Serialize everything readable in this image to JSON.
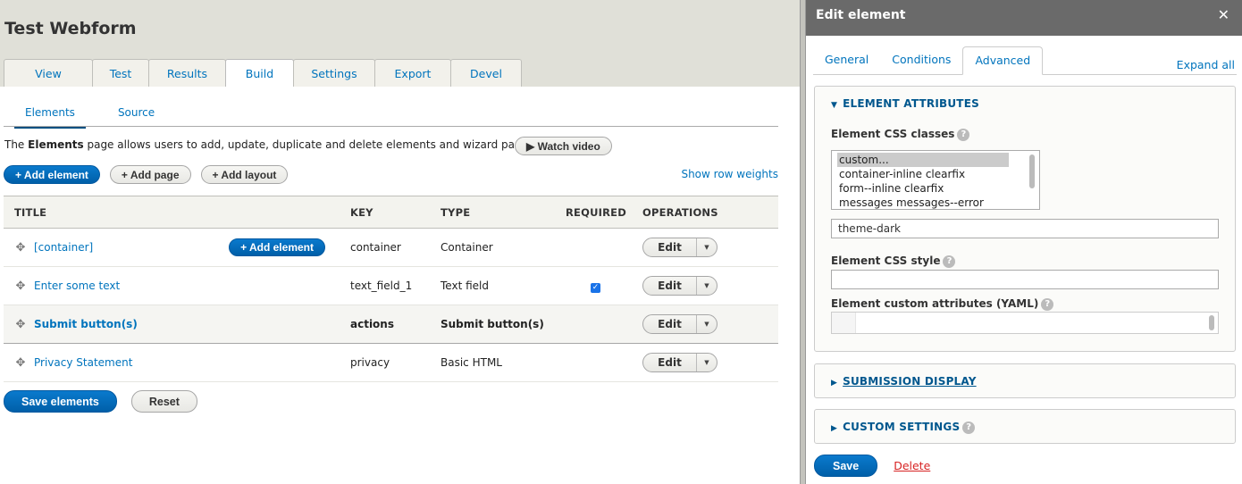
{
  "page": {
    "title": "Test Webform",
    "tabs": [
      {
        "label": "View",
        "active": false
      },
      {
        "label": "Test",
        "active": false
      },
      {
        "label": "Results",
        "active": false
      },
      {
        "label": "Build",
        "active": true
      },
      {
        "label": "Settings",
        "active": false
      },
      {
        "label": "Export",
        "active": false
      },
      {
        "label": "Devel",
        "active": false
      }
    ],
    "subtabs": [
      {
        "label": "Elements",
        "active": true
      },
      {
        "label": "Source",
        "active": false
      }
    ],
    "description": {
      "prefix": "The ",
      "bold": "Elements",
      "suffix": " page allows users to add, update, duplicate and delete elements and wizard pages."
    },
    "watch_video_label": "▶ Watch video",
    "buttons": {
      "add_element": "+ Add element",
      "add_page": "+ Add page",
      "add_layout": "+ Add layout"
    },
    "show_row_weights": "Show row weights",
    "table": {
      "columns": [
        "TITLE",
        "KEY",
        "TYPE",
        "REQUIRED",
        "OPERATIONS"
      ],
      "rows": [
        {
          "title": "[container]",
          "indent": false,
          "add_button": "+ Add element",
          "key": "container",
          "type": "Container",
          "required": false,
          "operation": "Edit"
        },
        {
          "title": "Enter some text",
          "indent": true,
          "key": "text_field_1",
          "type": "Text field",
          "required": true,
          "operation": "Edit"
        },
        {
          "title": "Submit button(s)",
          "indent": true,
          "key": "actions",
          "type": "Submit button(s)",
          "required": false,
          "operation": "Edit"
        },
        {
          "title": "Privacy Statement",
          "indent": false,
          "key": "privacy",
          "type": "Basic HTML",
          "required": false,
          "operation": "Edit"
        }
      ]
    },
    "save_label": "Save elements",
    "reset_label": "Reset"
  },
  "dialog": {
    "title": "Edit element",
    "close_glyph": "✕",
    "tabs": [
      {
        "label": "General",
        "active": false
      },
      {
        "label": "Conditions",
        "active": false
      },
      {
        "label": "Advanced",
        "active": true
      }
    ],
    "expand_all": "Expand all",
    "element_attributes": {
      "legend": "ELEMENT ATTRIBUTES",
      "css_classes_label": "Element CSS classes",
      "css_class_options": [
        "custom...",
        "container-inline clearfix",
        "form--inline clearfix",
        "messages messages--error"
      ],
      "css_class_selected": "custom...",
      "custom_class_value": "theme-dark",
      "css_style_label": "Element CSS style",
      "css_style_value": "",
      "custom_attributes_label": "Element custom attributes (YAML)",
      "custom_attributes_value": ""
    },
    "submission_display_legend": "SUBMISSION DISPLAY",
    "custom_settings_legend": "CUSTOM SETTINGS",
    "help_glyph": "?",
    "save_label": "Save",
    "delete_label": "Delete"
  },
  "colors": {
    "primary": "#0074bd",
    "header_bg": "#e0e0d8",
    "dialog_title_bg": "#6a6a6a",
    "danger": "#d72222"
  }
}
